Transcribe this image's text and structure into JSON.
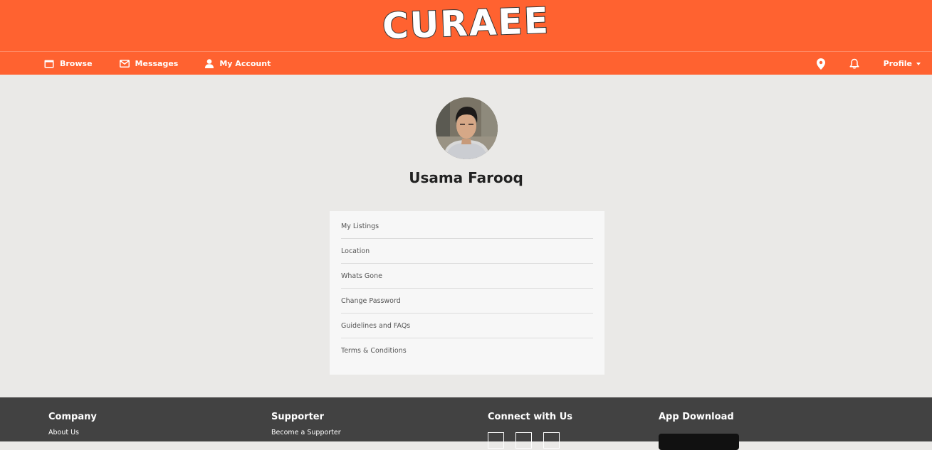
{
  "brand": {
    "logo_text": "CURAEE",
    "accent_color": "#ff6230",
    "footer_color": "#424242",
    "background_color": "#eae9e7"
  },
  "nav": {
    "left_items": [
      {
        "label": "Browse",
        "icon": "browse-icon"
      },
      {
        "label": "Messages",
        "icon": "envelope-icon"
      },
      {
        "label": "My Account",
        "icon": "user-icon"
      }
    ],
    "right": {
      "location_icon": "map-pin-icon",
      "notification_icon": "bell-icon",
      "profile_label": "Profile"
    }
  },
  "profile": {
    "name": "Usama Farooq"
  },
  "menu": {
    "items": [
      {
        "label": "My Listings"
      },
      {
        "label": "Location"
      },
      {
        "label": "Whats Gone"
      },
      {
        "label": "Change Password"
      },
      {
        "label": "Guidelines and FAQs"
      },
      {
        "label": "Terms & Conditions"
      }
    ]
  },
  "footer": {
    "company": {
      "heading": "Company",
      "links": [
        "About Us"
      ]
    },
    "supporter": {
      "heading": "Supporter",
      "links": [
        "Become a Supporter"
      ]
    },
    "connect": {
      "heading": "Connect with Us"
    },
    "app": {
      "heading": "App Download"
    }
  }
}
